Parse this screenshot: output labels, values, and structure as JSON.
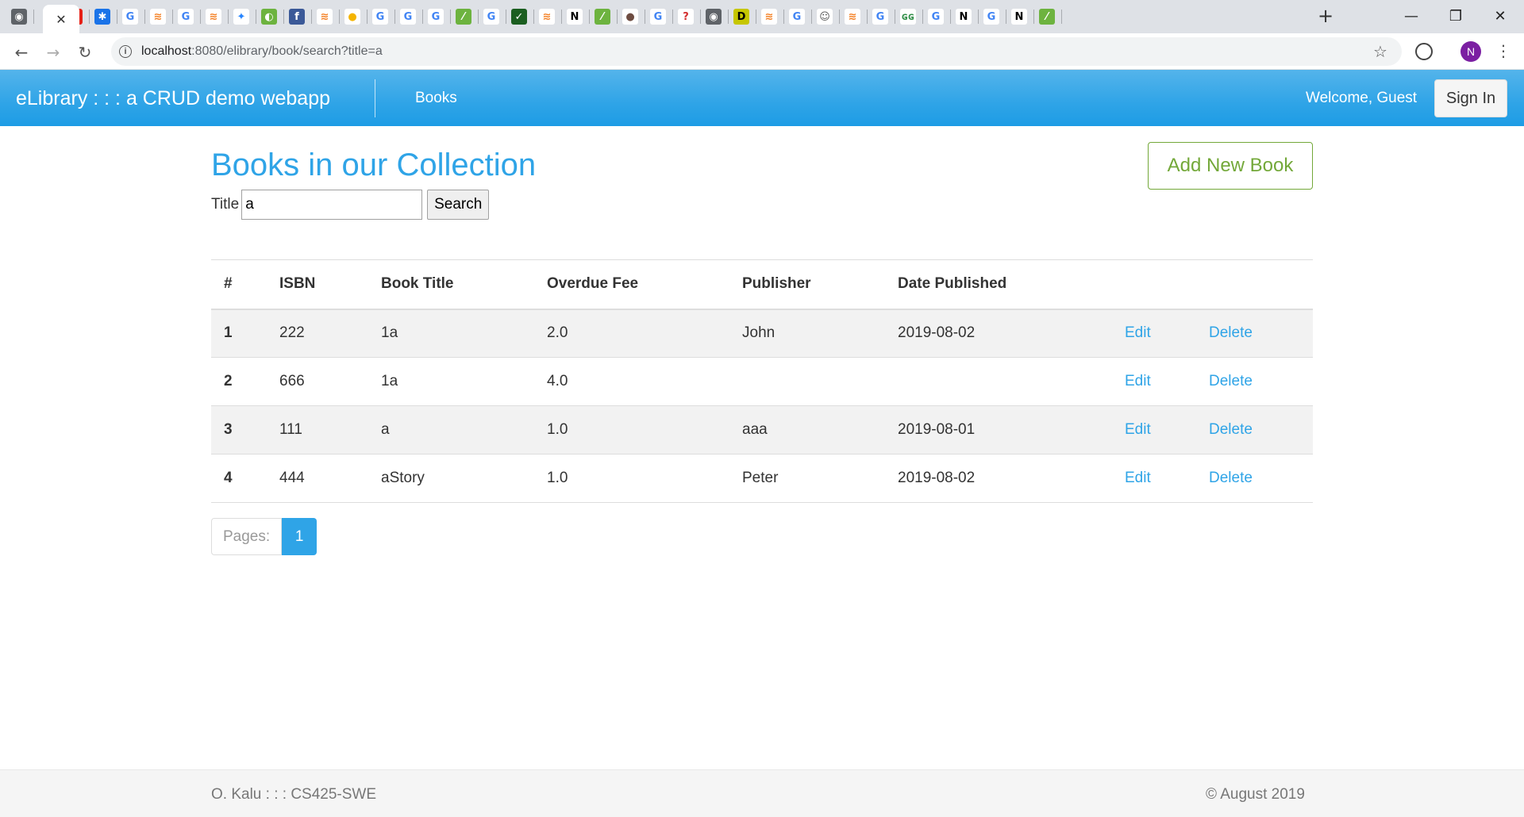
{
  "browser": {
    "tab_icons": [
      "globe-favicon",
      "close-tab",
      "youtube-favicon",
      "settings-favicon",
      "google-favicon",
      "stackoverflow-favicon",
      "google-favicon",
      "stackoverflow-favicon",
      "jira-favicon",
      "spring-favicon",
      "facebook-favicon",
      "stackoverflow-favicon",
      "fruit-favicon",
      "google-favicon",
      "google-favicon",
      "google-favicon",
      "spring-boot-favicon",
      "google-favicon",
      "check-favicon",
      "stackoverflow-favicon",
      "notion-favicon",
      "spring-boot-favicon",
      "bug-favicon",
      "google-favicon",
      "help-favicon",
      "globe-favicon",
      "d-favicon",
      "stackoverflow-favicon",
      "google-favicon",
      "anime-favicon",
      "stackoverflow-favicon",
      "google-favicon",
      "gfg-favicon",
      "google-favicon",
      "notion-favicon",
      "google-favicon",
      "notion-favicon",
      "spring-boot-favicon"
    ],
    "active_tab_close": "✕",
    "new_tab": "+",
    "url_host": "localhost",
    "url_path": ":8080/elibrary/book/search?title=a",
    "profile_initial": "N",
    "colors": {
      "tabstrip": "#dee1e6",
      "omnibox": "#f1f3f4",
      "profile": "#7b1fa2"
    }
  },
  "navbar": {
    "brand": "eLibrary : : : a CRUD demo webapp",
    "books_link": "Books",
    "welcome": "Welcome, Guest",
    "sign_in": "Sign In",
    "colors": {
      "primary": "#2fa4e7"
    }
  },
  "main": {
    "title": "Books in our Collection",
    "add_button": "Add New Book",
    "search": {
      "label": "Title",
      "value": "a",
      "button": "Search"
    },
    "table": {
      "headers": [
        "#",
        "ISBN",
        "Book Title",
        "Overdue Fee",
        "Publisher",
        "Date Published"
      ],
      "rows": [
        {
          "num": "1",
          "isbn": "222",
          "title": "1a",
          "fee": "2.0",
          "publisher": "John",
          "date": "2019-08-02",
          "edit": "Edit",
          "delete": "Delete"
        },
        {
          "num": "2",
          "isbn": "666",
          "title": "1a",
          "fee": "4.0",
          "publisher": "",
          "date": "",
          "edit": "Edit",
          "delete": "Delete"
        },
        {
          "num": "3",
          "isbn": "111",
          "title": "a",
          "fee": "1.0",
          "publisher": "aaa",
          "date": "2019-08-01",
          "edit": "Edit",
          "delete": "Delete"
        },
        {
          "num": "4",
          "isbn": "444",
          "title": "aStory",
          "fee": "1.0",
          "publisher": "Peter",
          "date": "2019-08-02",
          "edit": "Edit",
          "delete": "Delete"
        }
      ]
    },
    "pager": {
      "label": "Pages:",
      "current": "1"
    },
    "colors": {
      "add_button": "#73a839",
      "link": "#2fa4e7",
      "stripe": "#f2f2f2"
    }
  },
  "footer": {
    "left": "O. Kalu : : : CS425-SWE",
    "right": "© August 2019"
  }
}
